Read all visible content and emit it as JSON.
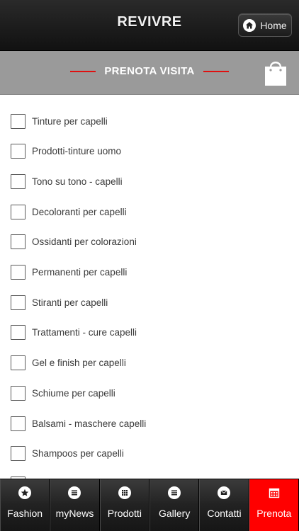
{
  "header": {
    "title": "REVIVRE",
    "home_label": "Home"
  },
  "section": {
    "title": "PRENOTA VISITA"
  },
  "checklist": [
    {
      "label": "Tinture per capelli",
      "checked": false
    },
    {
      "label": "Prodotti-tinture uomo",
      "checked": false
    },
    {
      "label": "Tono su tono - capelli",
      "checked": false
    },
    {
      "label": "Decoloranti per capelli",
      "checked": false
    },
    {
      "label": "Ossidanti per colorazioni",
      "checked": false
    },
    {
      "label": "Permanenti per capelli",
      "checked": false
    },
    {
      "label": "Stiranti per capelli",
      "checked": false
    },
    {
      "label": "Trattamenti - cure capelli",
      "checked": false
    },
    {
      "label": "Gel e finish per capelli",
      "checked": false
    },
    {
      "label": "Schiume per capelli",
      "checked": false
    },
    {
      "label": "Balsami - maschere capelli",
      "checked": false
    },
    {
      "label": "Shampoos per capelli",
      "checked": false
    }
  ],
  "tabs": [
    {
      "label": "Fashion",
      "icon": "star-icon",
      "active": false
    },
    {
      "label": "myNews",
      "icon": "list-icon",
      "active": false
    },
    {
      "label": "Prodotti",
      "icon": "grid-icon",
      "active": false
    },
    {
      "label": "Gallery",
      "icon": "list-icon",
      "active": false
    },
    {
      "label": "Contatti",
      "icon": "mail-icon",
      "active": false
    },
    {
      "label": "Prenota",
      "icon": "calendar-icon",
      "active": true
    }
  ],
  "colors": {
    "accent": "#ff0000",
    "header": "#1a1a1a",
    "section_bar": "#9a9a9a",
    "divider": "#e01010"
  }
}
